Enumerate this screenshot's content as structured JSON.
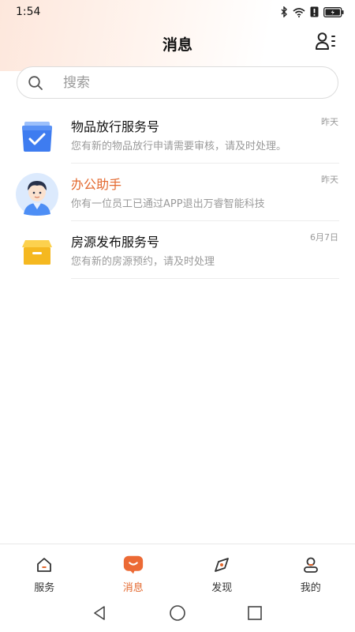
{
  "status_bar": {
    "time": "1:54",
    "icons": [
      "bluetooth-icon",
      "wifi-icon",
      "alert-icon",
      "battery-icon"
    ]
  },
  "header": {
    "title": "消息",
    "contacts_icon": "contacts-icon"
  },
  "search": {
    "placeholder": "搜索",
    "value": ""
  },
  "messages": [
    {
      "title": "物品放行服务号",
      "time": "昨天",
      "preview": "您有新的物品放行申请需要审核，请及时处理。",
      "icon": "approval-box-icon",
      "icon_color": "#3e7cf0"
    },
    {
      "title": "办公助手",
      "time": "昨天",
      "preview": "你有一位员工已通过APP退出万睿智能科技",
      "icon": "assistant-avatar-icon",
      "title_color": "#e3682e"
    },
    {
      "title": "房源发布服务号",
      "time": "6月7日",
      "preview": "您有新的房源预约，请及时处理",
      "icon": "archive-box-icon",
      "icon_color": "#f5b820"
    }
  ],
  "tabbar": {
    "tabs": [
      {
        "label": "服务",
        "icon": "home-icon",
        "active": false
      },
      {
        "label": "消息",
        "icon": "chat-icon",
        "active": true
      },
      {
        "label": "发现",
        "icon": "compass-icon",
        "active": false
      },
      {
        "label": "我的",
        "icon": "user-icon",
        "active": false
      }
    ],
    "accent_color": "#e3682e"
  },
  "system_nav": [
    "back-icon",
    "home-circle-icon",
    "recents-icon"
  ]
}
